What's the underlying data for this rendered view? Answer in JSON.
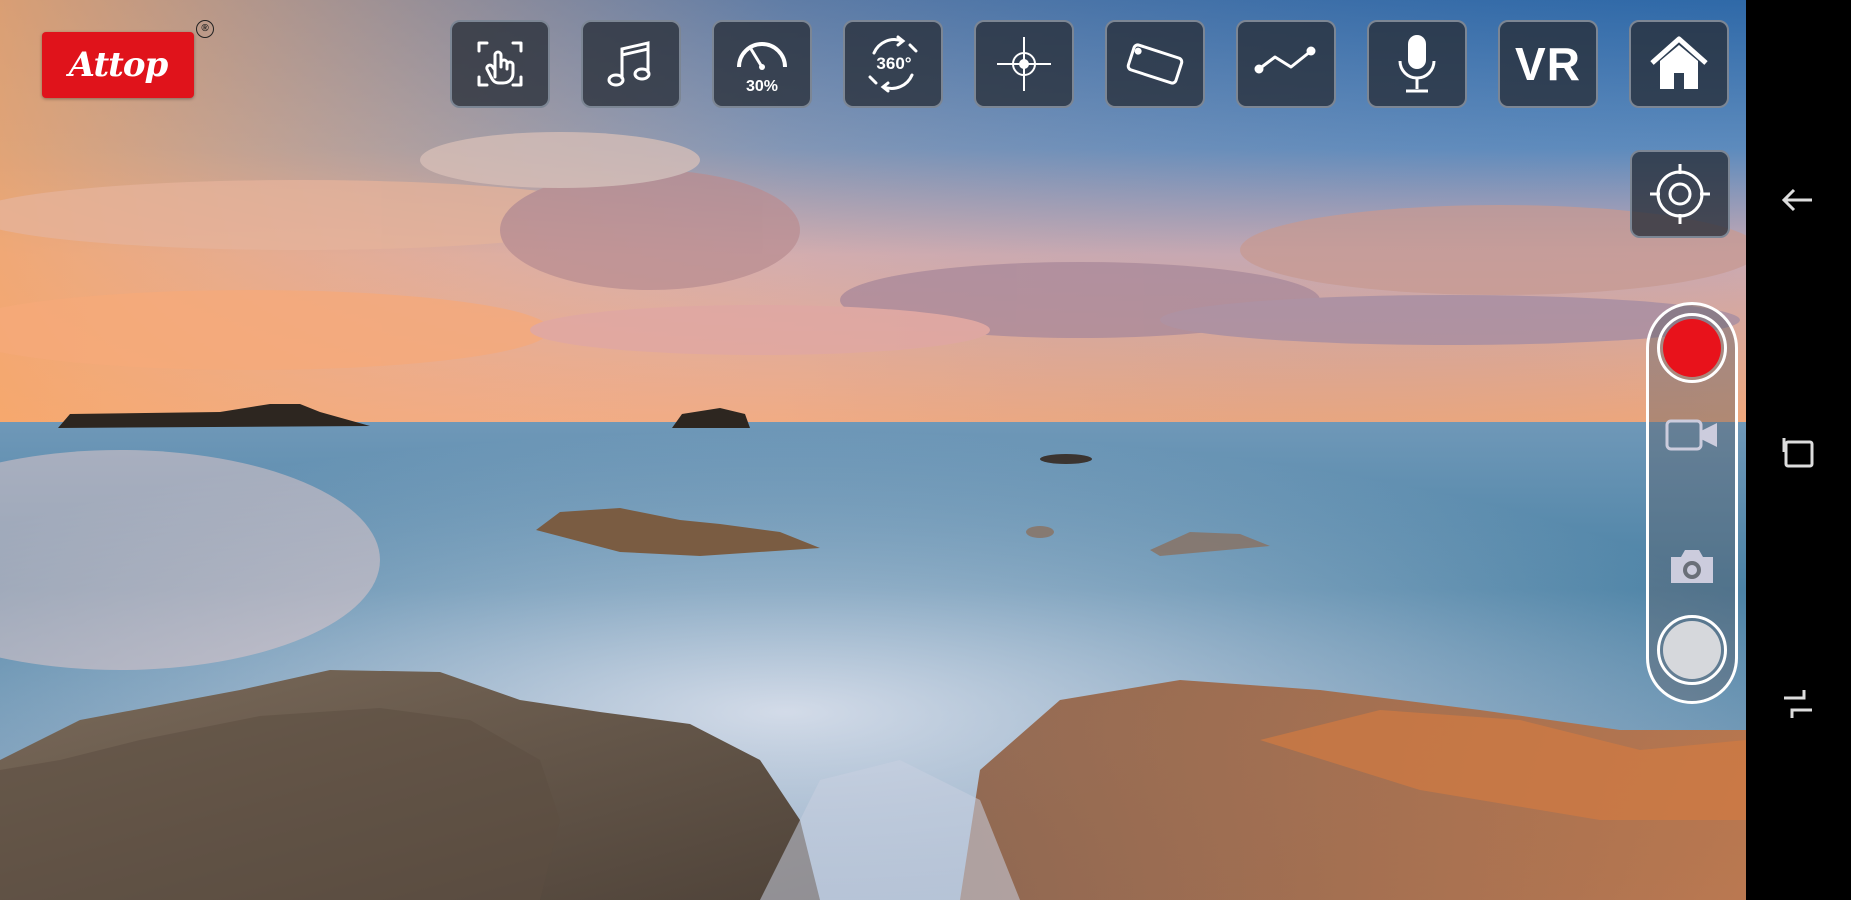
{
  "app": {
    "logo_text": "Attop",
    "logo_reg": "®"
  },
  "toolbar": {
    "gesture": {
      "icon": "gesture-hand-icon"
    },
    "music": {
      "icon": "music-note-icon"
    },
    "speed": {
      "icon": "speed-gauge-icon",
      "label": "30%"
    },
    "rotate360": {
      "icon": "rotate-360-icon",
      "label": "360°"
    },
    "headless": {
      "icon": "compass-crosshair-icon"
    },
    "flip": {
      "icon": "flip-phone-icon"
    },
    "route": {
      "icon": "flight-path-icon"
    },
    "voice": {
      "icon": "microphone-icon"
    },
    "vr": {
      "label": "VR"
    },
    "home": {
      "icon": "home-icon"
    }
  },
  "side": {
    "calibrate": {
      "icon": "gyro-calibrate-icon"
    }
  },
  "capture": {
    "record_color": "#e8121b",
    "video_icon": "video-camera-icon",
    "photo_icon": "photo-camera-icon"
  },
  "navbar": {
    "back": "back-arrow-icon",
    "recents": "recents-icon",
    "home": "nav-home-icon"
  }
}
